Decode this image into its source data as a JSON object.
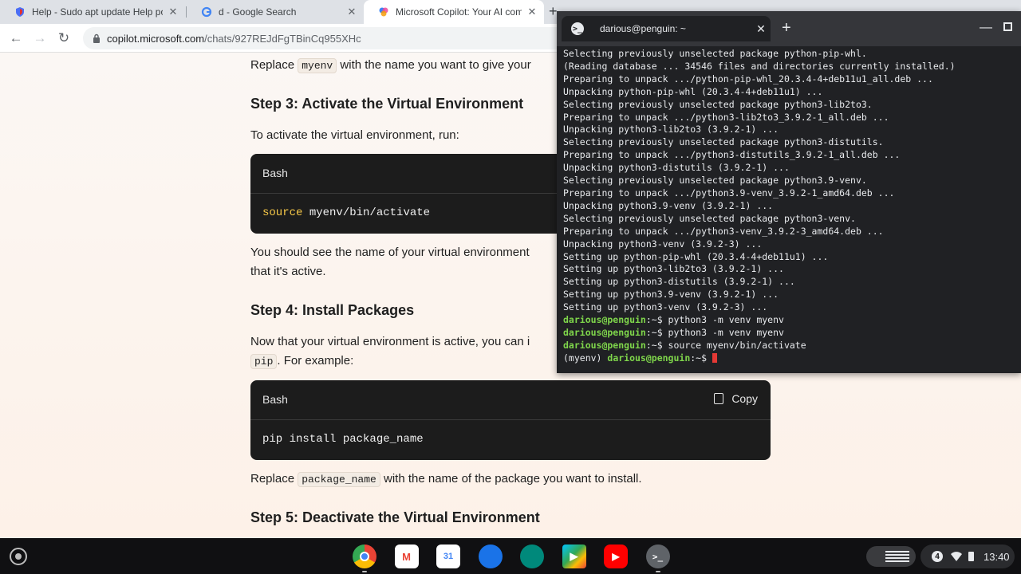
{
  "browser": {
    "tabs": [
      {
        "title": "Help - Sudo apt update Help po",
        "active": false
      },
      {
        "title": "d - Google Search",
        "active": false
      },
      {
        "title": "Microsoft Copilot: Your AI comp",
        "active": true
      }
    ],
    "url_domain": "copilot.microsoft.com",
    "url_path": "/chats/927REJdFgTBinCq955XHc"
  },
  "page": {
    "p1_before": "Replace",
    "p1_code": "myenv",
    "p1_after": "with the name you want to give your",
    "step3_title": "Step 3: Activate the Virtual Environment",
    "step3_intro": "To activate the virtual environment, run:",
    "code1_lang": "Bash",
    "code1_kw": "source",
    "code1_rest": " myenv/bin/activate",
    "p2_line1": "You should see the name of your virtual environment",
    "p2_line2": "that it's active.",
    "step4_title": "Step 4: Install Packages",
    "step4_line1": "Now that your virtual environment is active, you can i",
    "step4_code": "pip",
    "step4_after": ". For example:",
    "code2_lang": "Bash",
    "code2_copy": "Copy",
    "code2_line": "pip install package_name",
    "p3_before": "Replace",
    "p3_code": "package_name",
    "p3_after": "with the name of the package you want to install.",
    "step5_title": "Step 5: Deactivate the Virtual Environment"
  },
  "terminal": {
    "tab_title": "darious@penguin: ~",
    "output_lines": [
      "Selecting previously unselected package python-pip-whl.",
      "(Reading database ... 34546 files and directories currently installed.)",
      "Preparing to unpack .../python-pip-whl_20.3.4-4+deb11u1_all.deb ...",
      "Unpacking python-pip-whl (20.3.4-4+deb11u1) ...",
      "Selecting previously unselected package python3-lib2to3.",
      "Preparing to unpack .../python3-lib2to3_3.9.2-1_all.deb ...",
      "Unpacking python3-lib2to3 (3.9.2-1) ...",
      "Selecting previously unselected package python3-distutils.",
      "Preparing to unpack .../python3-distutils_3.9.2-1_all.deb ...",
      "Unpacking python3-distutils (3.9.2-1) ...",
      "Selecting previously unselected package python3.9-venv.",
      "Preparing to unpack .../python3.9-venv_3.9.2-1_amd64.deb ...",
      "Unpacking python3.9-venv (3.9.2-1) ...",
      "Selecting previously unselected package python3-venv.",
      "Preparing to unpack .../python3-venv_3.9.2-3_amd64.deb ...",
      "Unpacking python3-venv (3.9.2-3) ...",
      "Setting up python-pip-whl (20.3.4-4+deb11u1) ...",
      "Setting up python3-lib2to3 (3.9.2-1) ...",
      "Setting up python3-distutils (3.9.2-1) ...",
      "Setting up python3.9-venv (3.9.2-1) ...",
      "Setting up python3-venv (3.9.2-3) ..."
    ],
    "prompt": "darious@penguin",
    "prompt_suffix": ":~$ ",
    "commands": [
      "python3 -m venv myenv",
      "python3 -m venv myenv",
      "source myenv/bin/activate"
    ],
    "venv_prefix": "(myenv) "
  },
  "shelf": {
    "apps": [
      {
        "name": "chrome",
        "color": "#db4437"
      },
      {
        "name": "gmail",
        "color": "#ea4335"
      },
      {
        "name": "calendar",
        "color": "#4285f4"
      },
      {
        "name": "messages",
        "color": "#1a73e8"
      },
      {
        "name": "meet",
        "color": "#00897b"
      },
      {
        "name": "play-store",
        "color": "#34a853"
      },
      {
        "name": "youtube",
        "color": "#ff0000"
      },
      {
        "name": "terminal",
        "color": "#3c4043"
      }
    ],
    "notification_count": "4",
    "time": "13:40"
  }
}
